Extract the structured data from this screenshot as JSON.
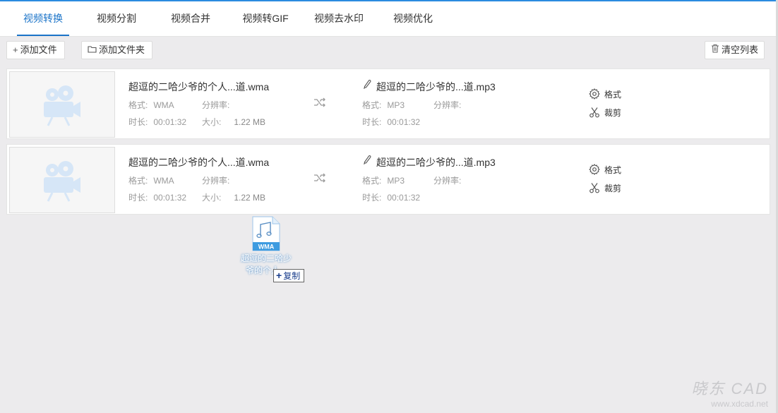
{
  "tabs": [
    {
      "label": "视频转换",
      "active": true
    },
    {
      "label": "视频分割"
    },
    {
      "label": "视频合并"
    },
    {
      "label": "视频转GIF"
    },
    {
      "label": "视频去水印"
    },
    {
      "label": "视频优化"
    }
  ],
  "toolbar": {
    "add_file": "添加文件",
    "add_folder": "添加文件夹",
    "clear_list": "清空列表"
  },
  "labels": {
    "format": "格式:",
    "resolution": "分辨率:",
    "duration": "时长:",
    "size": "大小:"
  },
  "files": [
    {
      "source": {
        "name": "超逗的二哈少爷的个人...道.wma",
        "format": "WMA",
        "resolution": "",
        "duration": "00:01:32",
        "size": "1.22 MB"
      },
      "output": {
        "name": "超逗的二哈少爷的...道.mp3",
        "format": "MP3",
        "resolution": "",
        "duration": "00:01:32"
      },
      "actions": {
        "format": "格式",
        "trim": "裁剪"
      }
    },
    {
      "source": {
        "name": "超逗的二哈少爷的个人...道.wma",
        "format": "WMA",
        "resolution": "",
        "duration": "00:01:32",
        "size": "1.22 MB"
      },
      "output": {
        "name": "超逗的二哈少爷的...道.mp3",
        "format": "MP3",
        "resolution": "",
        "duration": "00:01:32"
      },
      "actions": {
        "format": "格式",
        "trim": "裁剪"
      }
    }
  ],
  "drag": {
    "badge": "WMA",
    "name_line1": "超逗的二哈少",
    "name_line2": "爷的个人...",
    "copy_label": "复制"
  },
  "watermark": {
    "brand": "晓东 CAD",
    "url": "www.xdcad.net"
  },
  "colors": {
    "accent": "#1a73c8",
    "thumb_icon": "#d6e6f7",
    "file_badge": "#3d9be0"
  }
}
